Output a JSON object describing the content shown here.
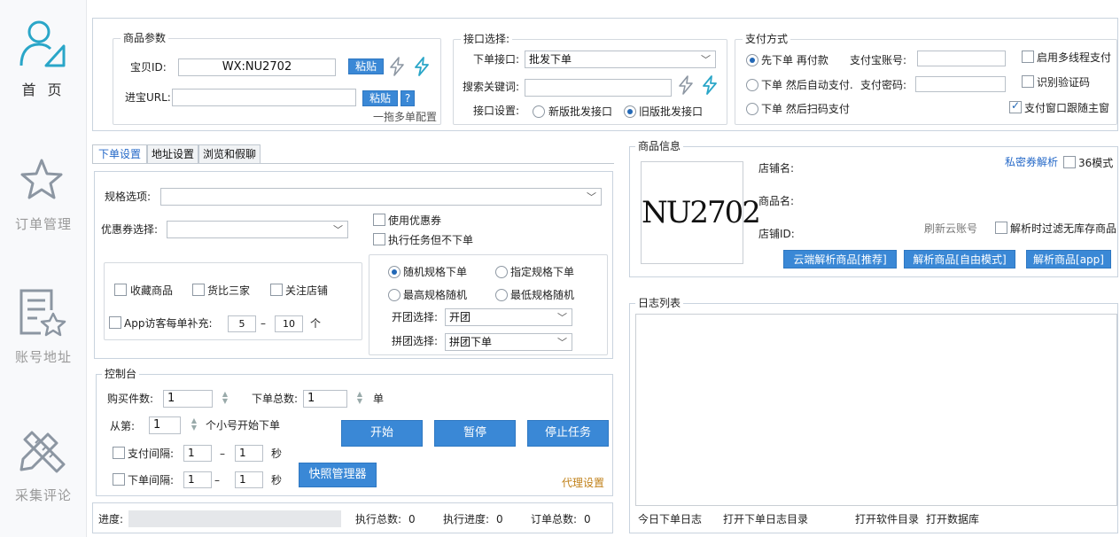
{
  "sidebar": {
    "items": [
      {
        "label": "首 页",
        "icon": "user-profile-icon",
        "active": true
      },
      {
        "label": "订单管理",
        "icon": "star-icon"
      },
      {
        "label": "账号地址",
        "icon": "document-star-icon"
      },
      {
        "label": "采集评论",
        "icon": "pencil-ruler-icon"
      }
    ]
  },
  "product_params": {
    "title": "商品参数",
    "item_id_label": "宝贝ID:",
    "item_id_value": "WX:NU2702",
    "paste_label": "粘贴",
    "url_label": "进宝URL:",
    "url_value": "",
    "help_label": "?",
    "drag_config_label": "一拖多单配置"
  },
  "interface": {
    "title": "接口选择:",
    "order_api_label": "下单接口:",
    "order_api_value": "批发下单",
    "keyword_label": "搜索关键词:",
    "keyword_value": "",
    "settings_label": "接口设置:",
    "option_new": "新版批发接口",
    "option_old": "旧版批发接口"
  },
  "payment": {
    "title": "支付方式",
    "option_1": "先下单 再付款",
    "option_2": "下单 然后自动支付.",
    "option_3": "下单 然后扫码支付",
    "alipay_account_label": "支付宝账号:",
    "alipay_password_label": "支付密码:",
    "multi_thread_label": "启用多线程支付",
    "captcha_label": "识别验证码",
    "follow_window_label": "支付窗口跟随主窗"
  },
  "tabs": [
    "下单设置",
    "地址设置",
    "浏览和假聊"
  ],
  "order_settings": {
    "spec_label": "规格选项:",
    "spec_value": "",
    "coupon_label": "优惠券选择:",
    "coupon_value": "",
    "use_coupon_label": "使用优惠券",
    "no_order_label": "执行任务但不下单",
    "fav_label": "收藏商品",
    "compare_label": "货比三家",
    "follow_shop_label": "关注店铺",
    "app_visitor_label": "App访客每单补充:",
    "app_visitor_min": "5",
    "app_visitor_dash": "–",
    "app_visitor_max": "10",
    "app_visitor_unit": "个",
    "random_spec": "随机规格下单",
    "fixed_spec": "指定规格下单",
    "highest_spec": "最高规格随机",
    "lowest_spec": "最低规格随机",
    "group_open_label": "开团选择:",
    "group_open_value": "开团",
    "group_join_label": "拼团选择:",
    "group_join_value": "拼团下单"
  },
  "console": {
    "title": "控制台",
    "qty_label": "购买件数:",
    "qty_value": "1",
    "total_label": "下单总数:",
    "total_value": "1",
    "total_unit": "单",
    "from_label": "从第:",
    "from_value": "1",
    "from_suffix": "个小号开始下单",
    "pay_interval_label": "支付间隔:",
    "pay_interval_min": "1",
    "pay_interval_max": "1",
    "order_interval_label": "下单间隔:",
    "order_interval_min": "1",
    "order_interval_max": "1",
    "dash": "–",
    "sec": "秒",
    "start_label": "开始",
    "pause_label": "暂停",
    "stop_label": "停止任务",
    "snapshot_label": "快照管理器",
    "proxy_label": "代理设置"
  },
  "status_bar": {
    "progress_label": "进度:",
    "exec_total_label": "执行总数:",
    "exec_total_value": "0",
    "exec_progress_label": "执行进度:",
    "exec_progress_value": "0",
    "order_total_label": "订单总数:",
    "order_total_value": "0"
  },
  "product_info": {
    "title": "商品信息",
    "image_text": "NU2702",
    "shop_name_label": "店铺名:",
    "product_name_label": "商品名:",
    "shop_id_label": "店铺ID:",
    "secret_coupon_label": "私密券解析",
    "mode36_label": "36模式",
    "refresh_cloud_label": "刷新云账号",
    "filter_label": "解析时过滤无库存商品",
    "cloud_parse_label": "云端解析商品[推荐]",
    "free_parse_label": "解析商品[自由模式]",
    "app_parse_label": "解析商品[app]"
  },
  "log": {
    "title": "日志列表",
    "today_label": "今日下单日志",
    "open_log_dir_label": "打开下单日志目录",
    "open_software_dir_label": "打开软件目录",
    "open_db_label": "打开数据库"
  },
  "colors": {
    "accent": "#3a88d6",
    "link": "#2468c8",
    "icon": "#2aa6c8"
  }
}
